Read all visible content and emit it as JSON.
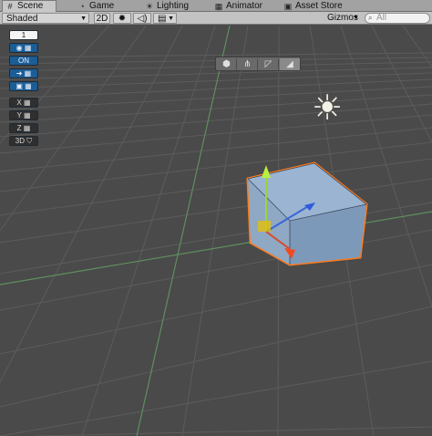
{
  "tabs": [
    {
      "label": "Scene",
      "icon": "grid-icon",
      "active": true
    },
    {
      "label": "Game",
      "icon": "pacman-icon",
      "active": false
    },
    {
      "label": "Lighting",
      "icon": "bulb-icon",
      "active": false
    },
    {
      "label": "Animator",
      "icon": "animator-icon",
      "active": false
    },
    {
      "label": "Asset Store",
      "icon": "store-icon",
      "active": false
    }
  ],
  "toolbar": {
    "shading_mode": "Shaded",
    "mode_2d": "2D",
    "gizmos": "Gizmos",
    "search_placeholder": "All"
  },
  "left_tools": {
    "layer_number": "1",
    "on_label": "ON",
    "x": "X",
    "y": "Y",
    "z": "Z",
    "three_d": "3D"
  },
  "orientation": [
    "cube-view-icon",
    "gizmo-axes-icon",
    "perspective-icon",
    "ortho-icon"
  ],
  "colors": {
    "background": "#4a4a4a",
    "grid": "#5e5e5e",
    "axis_green": "#5e8f5e",
    "selection_outline": "#ff7a1a",
    "cube_fill": "#8aa8c8"
  }
}
